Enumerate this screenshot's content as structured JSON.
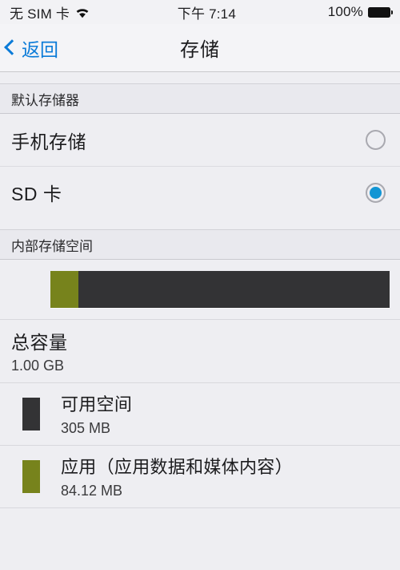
{
  "status_bar": {
    "carrier": "无 SIM 卡",
    "wifi_icon": "wifi-icon",
    "time": "下午 7:14",
    "battery_percent": "100%",
    "battery_icon": "battery-full-icon"
  },
  "nav": {
    "back_label": "返回",
    "back_icon": "chevron-left-icon",
    "title": "存储"
  },
  "default_storage": {
    "header": "默认存储器",
    "options": [
      {
        "label": "手机存储",
        "selected": false
      },
      {
        "label": "SD 卡",
        "selected": true
      }
    ]
  },
  "internal_storage": {
    "header": "内部存储空间",
    "bar": {
      "segments": [
        {
          "name": "应用（应用数据和媒体内容）",
          "color": "#77831c",
          "percent": 8.2
        },
        {
          "name": "可用空间",
          "color": "#333335",
          "percent": 91.8
        }
      ]
    },
    "total": {
      "label": "总容量",
      "value": "1.00 GB"
    },
    "legend": [
      {
        "color": "#333335",
        "label": "可用空间",
        "value": "305 MB"
      },
      {
        "color": "#77831c",
        "label": "应用（应用数据和媒体内容）",
        "value": "84.12 MB"
      }
    ]
  },
  "colors": {
    "accent_blue": "#1295d4",
    "link_blue": "#0b7bd8",
    "background": "#eeeef2",
    "section_header_bg": "#e9e9ee",
    "apps_olive": "#77831c",
    "free_dark": "#333335"
  }
}
